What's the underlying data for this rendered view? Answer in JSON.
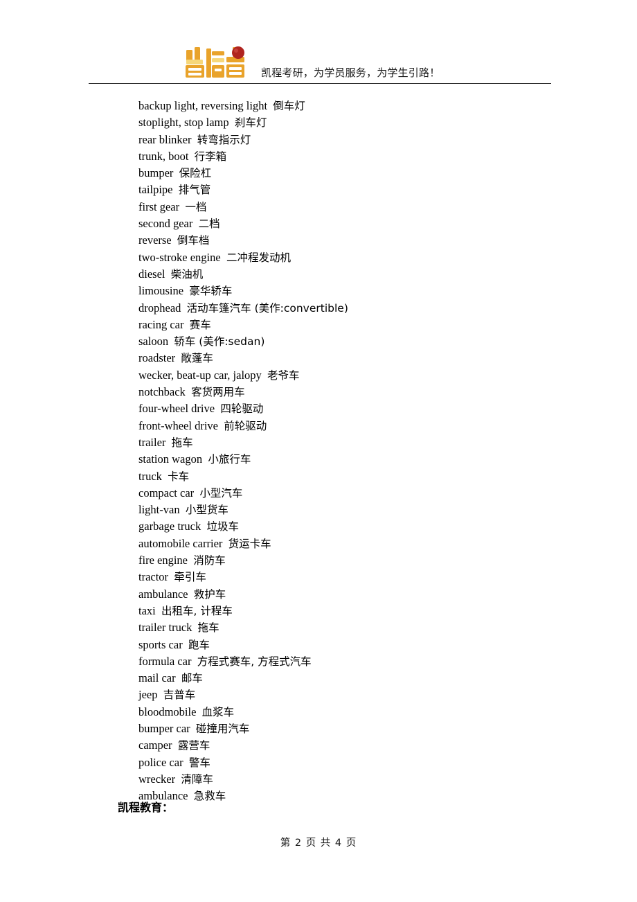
{
  "header": {
    "logo_alt": "凯程",
    "logo_colors": {
      "primary": "#E9A32B",
      "highlight": "#F6D77A",
      "accent": "#B0241F",
      "outline": "#D9881A"
    },
    "tagline": "凯程考研，为学员服务，为学生引路！"
  },
  "content": {
    "vocab_items": [
      {
        "en": "backup light, reversing light",
        "zh": "倒车灯"
      },
      {
        "en": "stoplight, stop lamp",
        "zh": "刹车灯"
      },
      {
        "en": "rear blinker",
        "zh": "转弯指示灯"
      },
      {
        "en": "trunk, boot",
        "zh": "行李箱"
      },
      {
        "en": "bumper",
        "zh": "保险杠"
      },
      {
        "en": "tailpipe",
        "zh": "排气管"
      },
      {
        "en": "first gear",
        "zh": "一档"
      },
      {
        "en": "second gear",
        "zh": "二档"
      },
      {
        "en": "reverse",
        "zh": "倒车档"
      },
      {
        "en": "two-stroke engine",
        "zh": "二冲程发动机"
      },
      {
        "en": "diesel",
        "zh": "柴油机"
      },
      {
        "en": "limousine",
        "zh": "豪华轿车"
      },
      {
        "en": "drophead",
        "zh": "活动车篷汽车 (美作:convertible)"
      },
      {
        "en": "racing car",
        "zh": "赛车"
      },
      {
        "en": "saloon",
        "zh": "轿车 (美作:sedan)"
      },
      {
        "en": "roadster",
        "zh": "敞蓬车"
      },
      {
        "en": "wecker, beat-up car, jalopy",
        "zh": "老爷车"
      },
      {
        "en": "notchback",
        "zh": "客货两用车"
      },
      {
        "en": "four-wheel drive",
        "zh": "四轮驱动"
      },
      {
        "en": "front-wheel drive",
        "zh": "前轮驱动"
      },
      {
        "en": "trailer",
        "zh": "拖车"
      },
      {
        "en": "station wagon",
        "zh": "小旅行车"
      },
      {
        "en": "truck",
        "zh": "卡车"
      },
      {
        "en": "compact car",
        "zh": "小型汽车"
      },
      {
        "en": "light-van",
        "zh": "小型货车"
      },
      {
        "en": "garbage truck",
        "zh": "垃圾车"
      },
      {
        "en": "automobile carrier",
        "zh": "货运卡车"
      },
      {
        "en": "fire engine",
        "zh": "消防车"
      },
      {
        "en": "tractor",
        "zh": "牵引车"
      },
      {
        "en": "ambulance",
        "zh": "救护车"
      },
      {
        "en": "taxi",
        "zh": "出租车, 计程车"
      },
      {
        "en": "trailer truck",
        "zh": "拖车"
      },
      {
        "en": "sports car",
        "zh": "跑车"
      },
      {
        "en": "formula car",
        "zh": "方程式赛车, 方程式汽车"
      },
      {
        "en": "mail car",
        "zh": "邮车"
      },
      {
        "en": "jeep",
        "zh": "吉普车"
      },
      {
        "en": "bloodmobile",
        "zh": "血浆车"
      },
      {
        "en": "bumper car",
        "zh": "碰撞用汽车"
      },
      {
        "en": "camper",
        "zh": "露营车"
      },
      {
        "en": "police car",
        "zh": "警车"
      },
      {
        "en": "wrecker",
        "zh": "清障车"
      },
      {
        "en": "ambulance",
        "zh": "急救车"
      }
    ],
    "section_label": "凯程教育："
  },
  "footer": {
    "page_text": "第 2 页 共 4 页",
    "current_page": 2,
    "total_pages": 4
  }
}
